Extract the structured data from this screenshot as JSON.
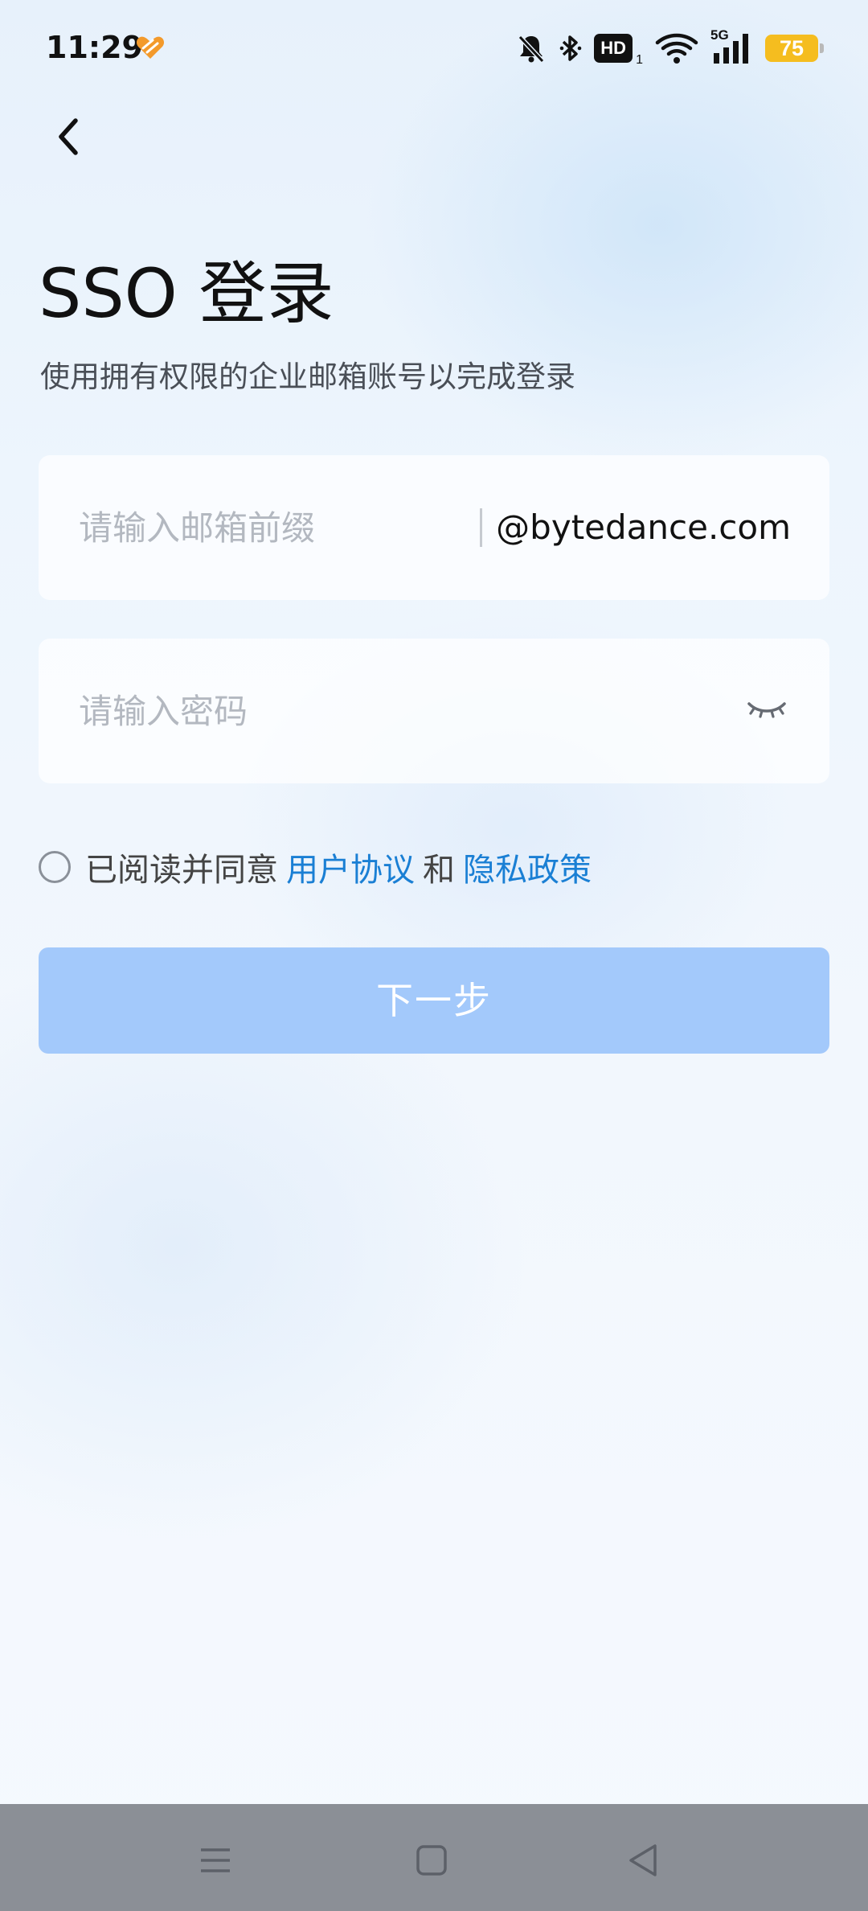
{
  "status_bar": {
    "time": "11:29",
    "app_icon": "orange-heart-app-icon",
    "icons": [
      "bell-muted-icon",
      "bluetooth-icon",
      "hd-voice-icon",
      "wifi-icon",
      "signal-5g-icon",
      "battery-icon"
    ],
    "hd_label": "HD",
    "hd_sub": "1",
    "network_label": "5G",
    "battery_level": "75",
    "battery_color": "#f5bd1f"
  },
  "header": {
    "back_icon": "chevron-left-icon",
    "title": "SSO 登录",
    "subtitle": "使用拥有权限的企业邮箱账号以完成登录"
  },
  "form": {
    "email_placeholder": "请输入邮箱前缀",
    "email_value": "",
    "email_domain": "@bytedance.com",
    "password_placeholder": "请输入密码",
    "password_value": "",
    "password_toggle_icon": "eye-closed-icon"
  },
  "agreement": {
    "checked": false,
    "prefix": "已阅读并同意",
    "user_agreement": "用户协议",
    "and": "和",
    "privacy_policy": "隐私政策",
    "link_color": "#1a7fd4"
  },
  "submit": {
    "label": "下一步",
    "enabled": false,
    "color": "#a3c9fb"
  },
  "nav_bar": {
    "icons": [
      "menu-icon",
      "home-icon",
      "back-triangle-icon"
    ]
  }
}
